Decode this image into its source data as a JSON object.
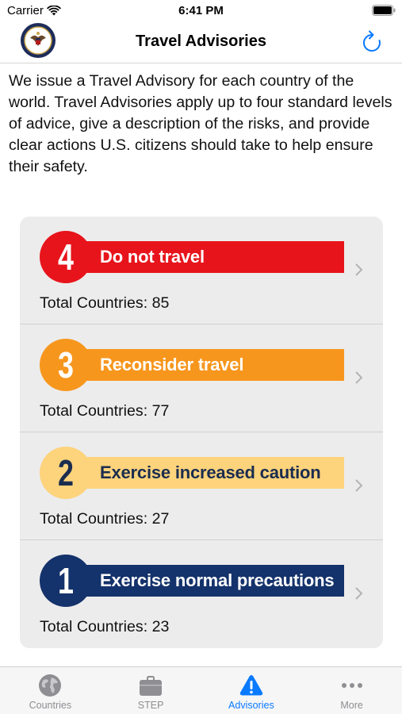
{
  "status_bar": {
    "carrier": "Carrier",
    "time": "6:41 PM"
  },
  "nav": {
    "title": "Travel Advisories",
    "left_icon": "state-department-seal-icon",
    "right_icon": "refresh-icon"
  },
  "intro": "We issue a Travel Advisory for each country of the world. Travel Advisories apply up to four standard levels of advice, give a description of the risks, and provide clear actions U.S. citizens should take to help ensure their safety.",
  "levels": [
    {
      "number": "4",
      "label": "Do not travel",
      "count_text": "Total Countries: 85",
      "color": "#e8141b",
      "text_color": "#ffffff",
      "num_color": "#ffffff"
    },
    {
      "number": "3",
      "label": "Reconsider travel",
      "count_text": "Total Countries: 77",
      "color": "#f7961d",
      "text_color": "#ffffff",
      "num_color": "#ffffff"
    },
    {
      "number": "2",
      "label": "Exercise increased caution",
      "count_text": "Total Countries: 27",
      "color": "#fdd37c",
      "text_color": "#1b2d4f",
      "num_color": "#1b2d4f"
    },
    {
      "number": "1",
      "label": "Exercise normal precautions",
      "count_text": "Total Countries: 23",
      "color": "#14326b",
      "text_color": "#ffffff",
      "num_color": "#ffffff"
    }
  ],
  "tabs": [
    {
      "label": "Countries",
      "icon": "globe-icon",
      "active": false
    },
    {
      "label": "STEP",
      "icon": "briefcase-icon",
      "active": false
    },
    {
      "label": "Advisories",
      "icon": "warning-icon",
      "active": true
    },
    {
      "label": "More",
      "icon": "more-icon",
      "active": false
    }
  ],
  "colors": {
    "accent": "#0a7aff",
    "inactive": "#8e8e93"
  }
}
